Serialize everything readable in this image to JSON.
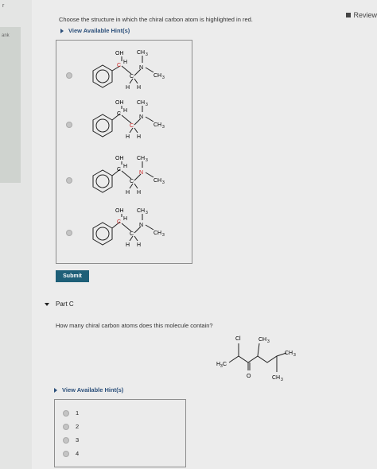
{
  "sidebar": {
    "top_mark": "r",
    "panel_text": "ank"
  },
  "header": {
    "review_label": "Review"
  },
  "part_b": {
    "question": "Choose the structure in which the chiral carbon atom is highlighted in red.",
    "hint_label": "View Available Hint(s)",
    "choices": [
      {
        "id": "choice-1",
        "selected": false
      },
      {
        "id": "choice-2",
        "selected": false
      },
      {
        "id": "choice-3",
        "selected": false
      },
      {
        "id": "choice-4",
        "selected": false
      }
    ],
    "molecule_labels": {
      "oh": "OH",
      "ch3": "CH",
      "sub3": "3",
      "n": "N",
      "c": "C",
      "h": "H"
    },
    "submit_label": "Submit"
  },
  "part_c": {
    "title": "Part C",
    "question": "How many chiral carbon atoms does this molecule contain?",
    "molecule_labels": {
      "cl": "Cl",
      "ch": "CH",
      "sub3": "3",
      "h3c": "H",
      "c": "C",
      "o": "O"
    },
    "hint_label": "View Available Hint(s)",
    "options": [
      "1",
      "2",
      "3",
      "4"
    ]
  },
  "colors": {
    "accent": "#1e5f78",
    "hint": "#2b4f7a",
    "chiral": "#cc2222"
  }
}
